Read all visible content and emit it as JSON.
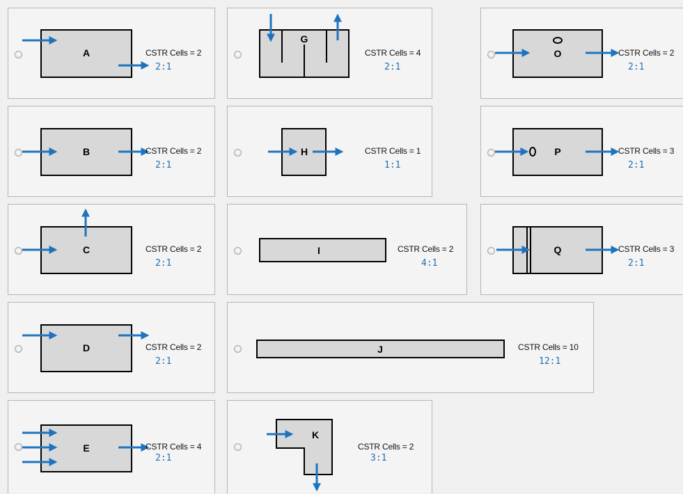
{
  "options": [
    {
      "id": "A",
      "cells": "CSTR Cells = 2",
      "ratio": "2:1"
    },
    {
      "id": "G",
      "cells": "CSTR Cells = 4",
      "ratio": "2:1"
    },
    {
      "id": "O",
      "cells": "CSTR Cells = 2",
      "ratio": "2:1"
    },
    {
      "id": "B",
      "cells": "CSTR Cells = 2",
      "ratio": "2:1"
    },
    {
      "id": "H",
      "cells": "CSTR Cells = 1",
      "ratio": "1:1"
    },
    {
      "id": "P",
      "cells": "CSTR Cells = 3",
      "ratio": "2:1"
    },
    {
      "id": "C",
      "cells": "CSTR Cells = 2",
      "ratio": "2:1"
    },
    {
      "id": "I",
      "cells": "CSTR Cells = 2",
      "ratio": "4:1"
    },
    {
      "id": "Q",
      "cells": "CSTR Cells = 3",
      "ratio": "2:1"
    },
    {
      "id": "D",
      "cells": "CSTR Cells = 2",
      "ratio": "2:1"
    },
    {
      "id": "J",
      "cells": "CSTR Cells = 10",
      "ratio": "12:1"
    },
    {
      "id": "E",
      "cells": "CSTR Cells = 4",
      "ratio": "2:1"
    },
    {
      "id": "K",
      "cells": "CSTR Cells = 2",
      "ratio": "3:1"
    }
  ],
  "colors": {
    "arrow": "#1e73be",
    "tank_fill": "#d8d8d8",
    "ratio_text": "#1e6fb3"
  }
}
